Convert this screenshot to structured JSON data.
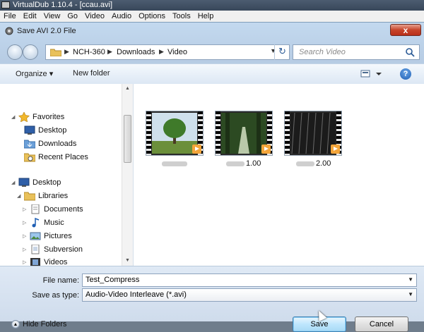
{
  "app": {
    "title": "VirtualDub 1.10.4 - [ccau.avi]",
    "menu": [
      "File",
      "Edit",
      "View",
      "Go",
      "Video",
      "Audio",
      "Options",
      "Tools",
      "Help"
    ]
  },
  "dialog": {
    "title": "Save AVI 2.0 File",
    "close_label": "x",
    "breadcrumb": [
      "NCH-360",
      "Downloads",
      "Video"
    ],
    "search_placeholder": "Search Video",
    "toolbar": {
      "organize": "Organize ▾",
      "new_folder": "New folder",
      "help": "?"
    },
    "nav": {
      "favorites": "Favorites",
      "favorites_items": [
        "Desktop",
        "Downloads",
        "Recent Places"
      ],
      "desktop": "Desktop",
      "libraries": "Libraries",
      "library_items": [
        "Documents",
        "Music",
        "Pictures",
        "Subversion",
        "Videos"
      ]
    },
    "files": [
      {
        "suffix": ""
      },
      {
        "suffix": "1.00"
      },
      {
        "suffix": "2.00"
      }
    ],
    "file_name_label": "File name:",
    "file_name_value": "Test_Compress",
    "save_type_label": "Save as type:",
    "save_type_value": "Audio-Video Interleave (*.avi)",
    "hide_folders": "Hide Folders",
    "save_button": "Save",
    "cancel_button": "Cancel"
  },
  "colors": {
    "accent": "#3c7fb1",
    "title_bg": "#38475a",
    "dialog_bg": "#bcd0e6"
  }
}
